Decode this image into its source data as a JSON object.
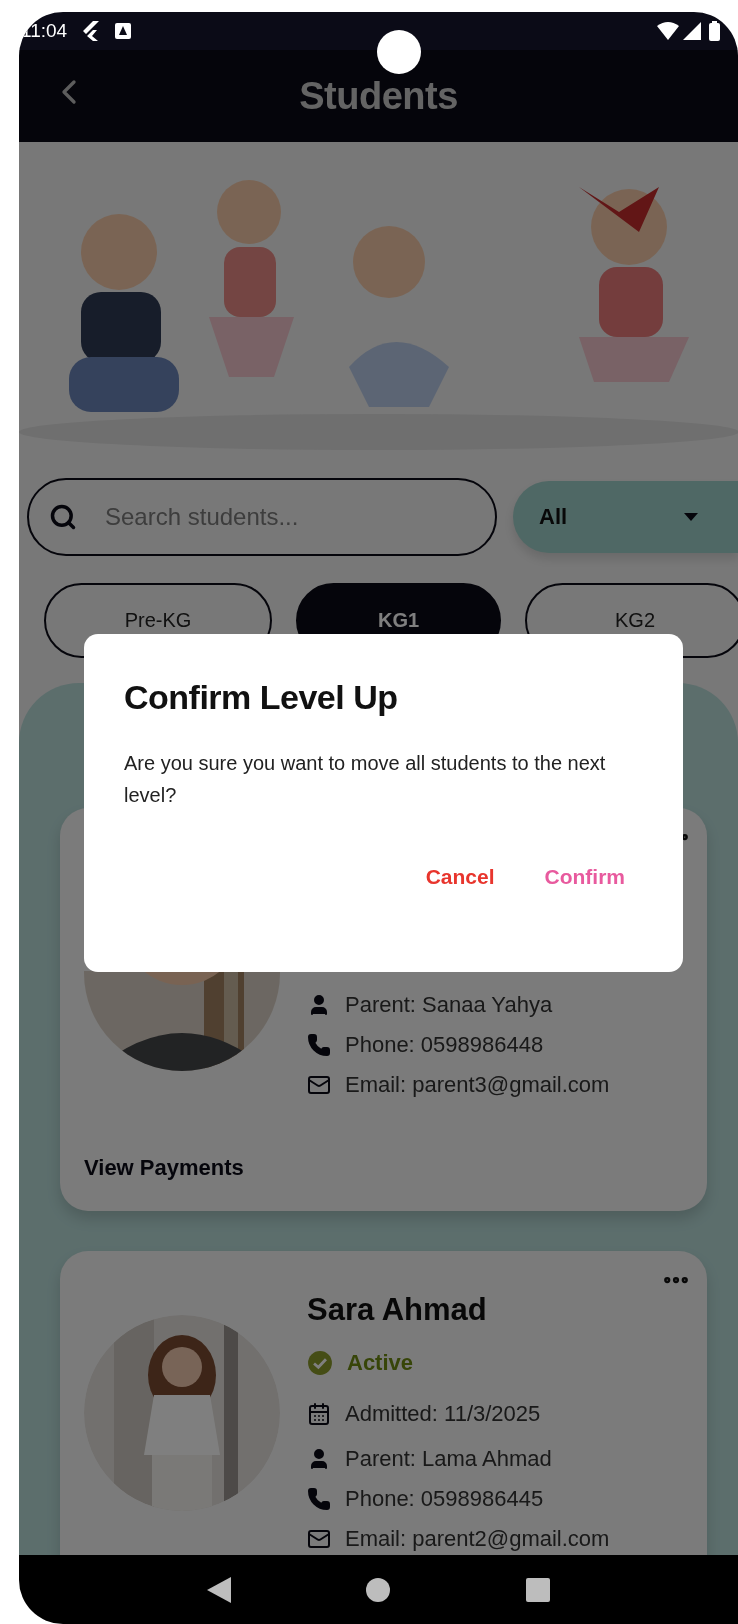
{
  "status_bar": {
    "time": "11:04"
  },
  "app_bar": {
    "title": "Students"
  },
  "search": {
    "placeholder": "Search students..."
  },
  "filter": {
    "value": "All"
  },
  "levels": [
    {
      "label": "Pre-KG",
      "selected": false
    },
    {
      "label": "KG1",
      "selected": true
    },
    {
      "label": "KG2",
      "selected": false
    }
  ],
  "students": [
    {
      "parent": "Parent: Sanaa Yahya",
      "phone": "Phone: 0598986448",
      "email": "Email: parent3@gmail.com",
      "action": "View Payments"
    },
    {
      "name": "Sara Ahmad",
      "status": "Active",
      "admitted": "Admitted: 11/3/2025",
      "parent": "Parent: Lama Ahmad",
      "phone": "Phone: 0598986445",
      "email": "Email: parent2@gmail.com"
    }
  ],
  "dialog": {
    "title": "Confirm Level Up",
    "message": "Are you sure you want to move all students to the next level?",
    "buttons": [
      {
        "label": "Cancel",
        "kind": "cancel"
      },
      {
        "label": "Confirm",
        "kind": "confirm"
      }
    ]
  }
}
